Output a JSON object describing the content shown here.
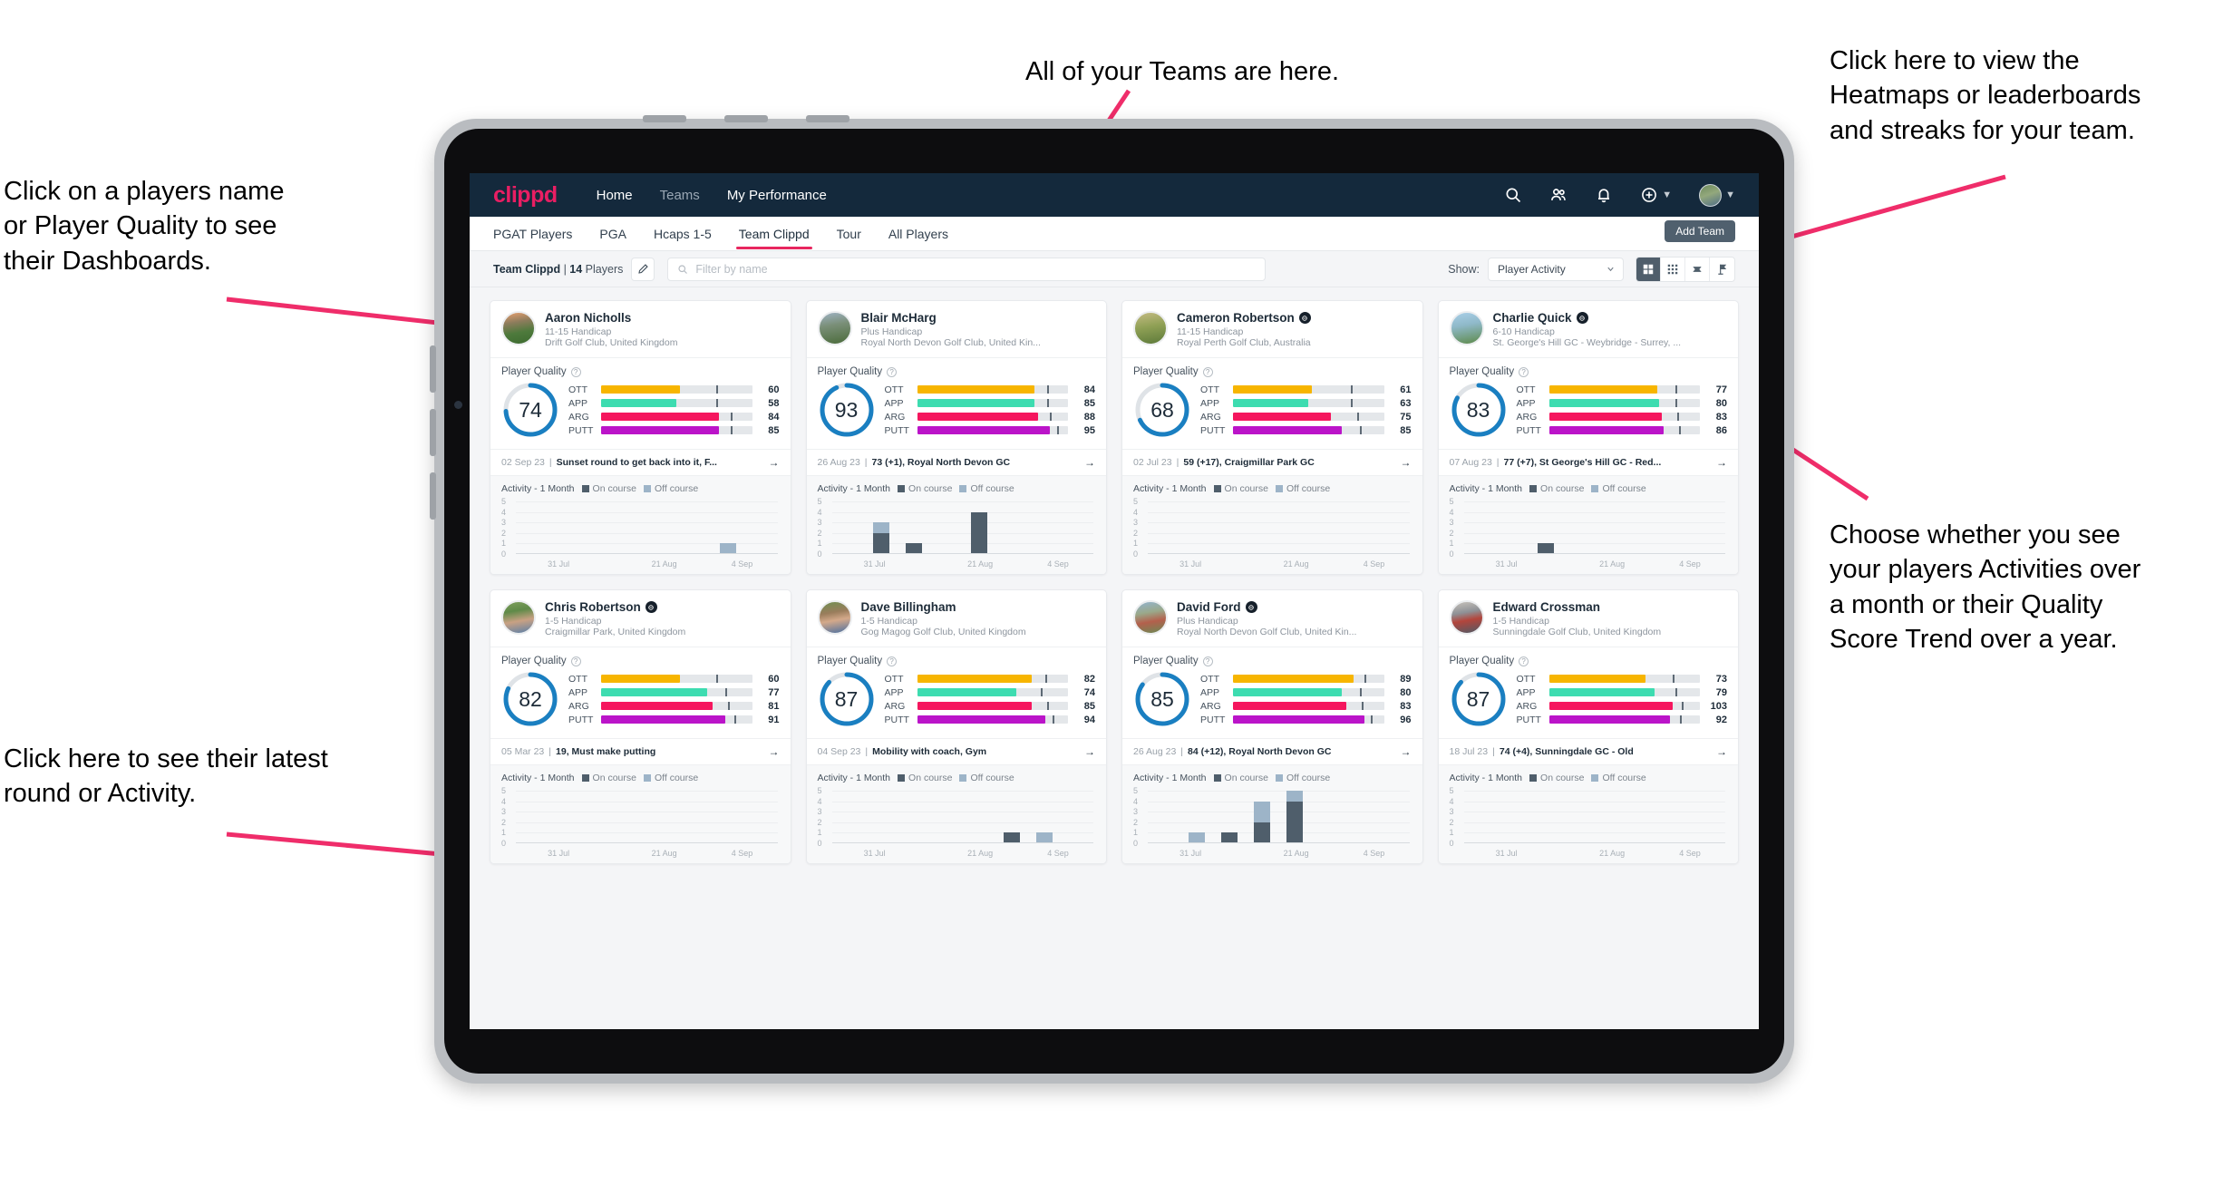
{
  "annotations": [
    {
      "id": "teams",
      "text": "All of your Teams are here."
    },
    {
      "id": "heatmaps",
      "text": "Click here to view the\nHeatmaps or leaderboards\nand streaks for your team."
    },
    {
      "id": "dashboards",
      "text": "Click on a players name\nor Player Quality to see\ntheir Dashboards."
    },
    {
      "id": "activity-choice",
      "text": "Choose whether you see\nyour players Activities over\na month or their Quality\nScore Trend over a year."
    },
    {
      "id": "latest-round",
      "text": "Click here to see their latest\nround or Activity."
    }
  ],
  "colors": {
    "brand": "#e8265f",
    "navbar": "#14293c",
    "ott": "#f7b500",
    "app": "#3ddcb0",
    "arg": "#f5165e",
    "putt": "#bb14c9",
    "ring": "#1a7fc1",
    "on_course": "#4f5e6b",
    "off_course": "#9db4c8"
  },
  "topnav": {
    "logo": "clippd",
    "links": [
      {
        "label": "Home",
        "active": true
      },
      {
        "label": "Teams",
        "active": false
      },
      {
        "label": "My Performance",
        "active": true
      }
    ],
    "icons": [
      "search-icon",
      "people-icon",
      "bell-icon",
      "plus-circle-icon",
      "avatar"
    ]
  },
  "tabs": [
    {
      "label": "PGAT Players",
      "active": false
    },
    {
      "label": "PGA",
      "active": false
    },
    {
      "label": "Hcaps 1-5",
      "active": false
    },
    {
      "label": "Team Clippd",
      "active": true
    },
    {
      "label": "Tour",
      "active": false
    },
    {
      "label": "All Players",
      "active": false
    }
  ],
  "add_team_label": "Add Team",
  "filterbar": {
    "team_name": "Team Clippd",
    "separator": " | ",
    "player_count": "14",
    "players_word": " Players",
    "search_placeholder": "Filter by name",
    "show_label": "Show:",
    "show_value": "Player Activity",
    "view_buttons": [
      "grid-view-icon",
      "dense-grid-icon",
      "heatmap-icon",
      "leaderboard-icon"
    ],
    "view_selected_index": 0
  },
  "card_labels": {
    "player_quality": "Player Quality",
    "metrics": [
      "OTT",
      "APP",
      "ARG",
      "PUTT"
    ],
    "activity_title": "Activity - 1 Month",
    "legend_on": "On course",
    "legend_off": "Off course",
    "y_ticks": [
      "5",
      "4",
      "3",
      "2",
      "1",
      "0"
    ],
    "x_ticks": [
      "31 Jul",
      "21 Aug",
      "4 Sep"
    ]
  },
  "players": [
    {
      "name": "Aaron Nicholls",
      "verified": false,
      "handicap": "11-15 Handicap",
      "club": "Drift Golf Club, United Kingdom",
      "avatar_css": "linear-gradient(170deg,#e8a071 0%,#8c7c5c 32%,#4e7a3c 62%,#3d6b30 100%)",
      "quality": 74,
      "metrics": [
        {
          "key": "OTT",
          "value": 60,
          "fill": 52,
          "mark": 76
        },
        {
          "key": "APP",
          "value": 58,
          "fill": 50,
          "mark": 76
        },
        {
          "key": "ARG",
          "value": 84,
          "fill": 78,
          "mark": 86
        },
        {
          "key": "PUTT",
          "value": 85,
          "fill": 78,
          "mark": 86
        }
      ],
      "round_date": "02 Sep 23",
      "round_text": "Sunset round to get back into it, F...",
      "activity": [
        {
          "on": 0,
          "off": 0
        },
        {
          "on": 0,
          "off": 0
        },
        {
          "on": 0,
          "off": 0
        },
        {
          "on": 0,
          "off": 0
        },
        {
          "on": 0,
          "off": 0
        },
        {
          "on": 0,
          "off": 0
        },
        {
          "on": 0,
          "off": 1
        },
        {
          "on": 0,
          "off": 0
        }
      ]
    },
    {
      "name": "Blair McHarg",
      "verified": false,
      "handicap": "Plus Handicap",
      "club": "Royal North Devon Golf Club, United Kin...",
      "avatar_css": "linear-gradient(170deg,#9fb3c4 0%,#7a8f78 40%,#4a6b3a 100%)",
      "quality": 93,
      "metrics": [
        {
          "key": "OTT",
          "value": 84,
          "fill": 78,
          "mark": 86
        },
        {
          "key": "APP",
          "value": 85,
          "fill": 78,
          "mark": 86
        },
        {
          "key": "ARG",
          "value": 88,
          "fill": 80,
          "mark": 88
        },
        {
          "key": "PUTT",
          "value": 95,
          "fill": 88,
          "mark": 93
        }
      ],
      "round_date": "26 Aug 23",
      "round_text": "73 (+1), Royal North Devon GC",
      "activity": [
        {
          "on": 0,
          "off": 0
        },
        {
          "on": 2,
          "off": 1
        },
        {
          "on": 1,
          "off": 0
        },
        {
          "on": 0,
          "off": 0
        },
        {
          "on": 4,
          "off": 0
        },
        {
          "on": 0,
          "off": 0
        },
        {
          "on": 0,
          "off": 0
        },
        {
          "on": 0,
          "off": 0
        }
      ]
    },
    {
      "name": "Cameron Robertson",
      "verified": true,
      "handicap": "11-15 Handicap",
      "club": "Royal Perth Golf Club, Australia",
      "avatar_css": "linear-gradient(170deg,#c4bb83 0%,#8fa055 45%,#5d7a3a 100%)",
      "quality": 68,
      "metrics": [
        {
          "key": "OTT",
          "value": 61,
          "fill": 52,
          "mark": 78
        },
        {
          "key": "APP",
          "value": 63,
          "fill": 50,
          "mark": 78
        },
        {
          "key": "ARG",
          "value": 75,
          "fill": 65,
          "mark": 82
        },
        {
          "key": "PUTT",
          "value": 85,
          "fill": 72,
          "mark": 84
        }
      ],
      "round_date": "02 Jul 23",
      "round_text": "59 (+17), Craigmillar Park GC",
      "activity": [
        {
          "on": 0,
          "off": 0
        },
        {
          "on": 0,
          "off": 0
        },
        {
          "on": 0,
          "off": 0
        },
        {
          "on": 0,
          "off": 0
        },
        {
          "on": 0,
          "off": 0
        },
        {
          "on": 0,
          "off": 0
        },
        {
          "on": 0,
          "off": 0
        },
        {
          "on": 0,
          "off": 0
        }
      ]
    },
    {
      "name": "Charlie Quick",
      "verified": true,
      "handicap": "6-10 Handicap",
      "club": "St. George's Hill GC - Weybridge - Surrey, ...",
      "avatar_css": "linear-gradient(170deg,#a9cfe8 0%,#8fb9c9 40%,#5d8a4a 100%)",
      "quality": 83,
      "metrics": [
        {
          "key": "OTT",
          "value": 77,
          "fill": 72,
          "mark": 84
        },
        {
          "key": "APP",
          "value": 80,
          "fill": 73,
          "mark": 84
        },
        {
          "key": "ARG",
          "value": 83,
          "fill": 75,
          "mark": 85
        },
        {
          "key": "PUTT",
          "value": 86,
          "fill": 76,
          "mark": 86
        }
      ],
      "round_date": "07 Aug 23",
      "round_text": "77 (+7), St George's Hill GC - Red...",
      "activity": [
        {
          "on": 0,
          "off": 0
        },
        {
          "on": 0,
          "off": 0
        },
        {
          "on": 1,
          "off": 0
        },
        {
          "on": 0,
          "off": 0
        },
        {
          "on": 0,
          "off": 0
        },
        {
          "on": 0,
          "off": 0
        },
        {
          "on": 0,
          "off": 0
        },
        {
          "on": 0,
          "off": 0
        }
      ]
    },
    {
      "name": "Chris Robertson",
      "verified": true,
      "handicap": "1-5 Handicap",
      "club": "Craigmillar Park, United Kingdom",
      "avatar_css": "linear-gradient(170deg,#7fa05e 0%,#5f8a48 30%,#c9a183 60%,#5a7fa8 100%)",
      "quality": 82,
      "metrics": [
        {
          "key": "OTT",
          "value": 60,
          "fill": 52,
          "mark": 76
        },
        {
          "key": "APP",
          "value": 77,
          "fill": 70,
          "mark": 82
        },
        {
          "key": "ARG",
          "value": 81,
          "fill": 74,
          "mark": 84
        },
        {
          "key": "PUTT",
          "value": 91,
          "fill": 82,
          "mark": 88
        }
      ],
      "round_date": "05 Mar 23",
      "round_text": "19, Must make putting",
      "activity": [
        {
          "on": 0,
          "off": 0
        },
        {
          "on": 0,
          "off": 0
        },
        {
          "on": 0,
          "off": 0
        },
        {
          "on": 0,
          "off": 0
        },
        {
          "on": 0,
          "off": 0
        },
        {
          "on": 0,
          "off": 0
        },
        {
          "on": 0,
          "off": 0
        },
        {
          "on": 0,
          "off": 0
        }
      ]
    },
    {
      "name": "Dave Billingham",
      "verified": false,
      "handicap": "1-5 Handicap",
      "club": "Gog Magog Golf Club, United Kingdom",
      "avatar_css": "linear-gradient(170deg,#6f8f52 0%,#9a7d5c 35%,#d4a98a 58%,#4a6fa0 100%)",
      "quality": 87,
      "metrics": [
        {
          "key": "OTT",
          "value": 82,
          "fill": 76,
          "mark": 85
        },
        {
          "key": "APP",
          "value": 74,
          "fill": 66,
          "mark": 82
        },
        {
          "key": "ARG",
          "value": 85,
          "fill": 76,
          "mark": 86
        },
        {
          "key": "PUTT",
          "value": 94,
          "fill": 85,
          "mark": 90
        }
      ],
      "round_date": "04 Sep 23",
      "round_text": "Mobility with coach, Gym",
      "activity": [
        {
          "on": 0,
          "off": 0
        },
        {
          "on": 0,
          "off": 0
        },
        {
          "on": 0,
          "off": 0
        },
        {
          "on": 0,
          "off": 0
        },
        {
          "on": 0,
          "off": 0
        },
        {
          "on": 1,
          "off": 0
        },
        {
          "on": 0,
          "off": 1
        },
        {
          "on": 0,
          "off": 0
        }
      ]
    },
    {
      "name": "David Ford",
      "verified": true,
      "handicap": "Plus Handicap",
      "club": "Royal North Devon Golf Club, United Kin...",
      "avatar_css": "linear-gradient(170deg,#93b4cf 0%,#9aa98a 35%,#b4604c 62%,#6a8a55 100%)",
      "quality": 85,
      "metrics": [
        {
          "key": "OTT",
          "value": 89,
          "fill": 80,
          "mark": 87
        },
        {
          "key": "APP",
          "value": 80,
          "fill": 72,
          "mark": 84
        },
        {
          "key": "ARG",
          "value": 83,
          "fill": 75,
          "mark": 85
        },
        {
          "key": "PUTT",
          "value": 96,
          "fill": 87,
          "mark": 91
        }
      ],
      "round_date": "26 Aug 23",
      "round_text": "84 (+12), Royal North Devon GC",
      "activity": [
        {
          "on": 0,
          "off": 0
        },
        {
          "on": 0,
          "off": 1
        },
        {
          "on": 1,
          "off": 0
        },
        {
          "on": 2,
          "off": 2
        },
        {
          "on": 4,
          "off": 1
        },
        {
          "on": 0,
          "off": 0
        },
        {
          "on": 0,
          "off": 0
        },
        {
          "on": 0,
          "off": 0
        }
      ]
    },
    {
      "name": "Edward Crossman",
      "verified": false,
      "handicap": "1-5 Handicap",
      "club": "Sunningdale Golf Club, United Kingdom",
      "avatar_css": "linear-gradient(170deg,#c9c4bc 0%,#8e9196 35%,#b3453c 58%,#4e5a66 100%)",
      "quality": 87,
      "metrics": [
        {
          "key": "OTT",
          "value": 73,
          "fill": 64,
          "mark": 82
        },
        {
          "key": "APP",
          "value": 79,
          "fill": 70,
          "mark": 84
        },
        {
          "key": "ARG",
          "value": 103,
          "fill": 82,
          "mark": 88
        },
        {
          "key": "PUTT",
          "value": 92,
          "fill": 80,
          "mark": 87
        }
      ],
      "round_date": "18 Jul 23",
      "round_text": "74 (+4), Sunningdale GC - Old",
      "activity": [
        {
          "on": 0,
          "off": 0
        },
        {
          "on": 0,
          "off": 0
        },
        {
          "on": 0,
          "off": 0
        },
        {
          "on": 0,
          "off": 0
        },
        {
          "on": 0,
          "off": 0
        },
        {
          "on": 0,
          "off": 0
        },
        {
          "on": 0,
          "off": 0
        },
        {
          "on": 0,
          "off": 0
        }
      ]
    }
  ]
}
